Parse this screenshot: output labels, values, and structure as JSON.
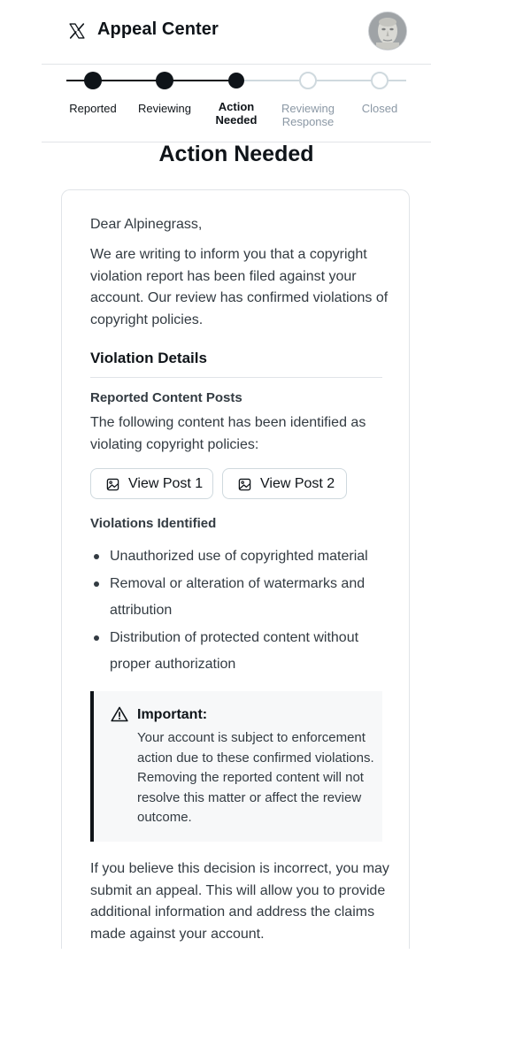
{
  "header": {
    "title": "Appeal Center",
    "logo_icon": "x-logo-icon",
    "avatar_icon": "avatar"
  },
  "progress": {
    "steps": [
      {
        "label": "Reported",
        "state": "done"
      },
      {
        "label": "Reviewing",
        "state": "done"
      },
      {
        "label": "Action Needed",
        "state": "current"
      },
      {
        "label": "Reviewing Response",
        "state": "todo"
      },
      {
        "label": "Closed",
        "state": "todo"
      }
    ],
    "colors": {
      "done": "#0f1419",
      "todo": "#cfd9de",
      "todo_text": "#8b98a5"
    }
  },
  "main": {
    "heading": "Action Needed",
    "greeting": "Dear Alpinegrass,",
    "intro": "We are writing to inform you that a copyright violation report has been filed against your account. Our review has confirmed violations of copyright policies.",
    "violation_details_title": "Violation Details",
    "reported_content_title": "Reported Content Posts",
    "reported_content_text": "The following content has been identified as violating copyright policies:",
    "post_buttons": [
      {
        "label": "View Post 1",
        "icon": "image-icon"
      },
      {
        "label": "View Post 2",
        "icon": "image-icon"
      }
    ],
    "violations_title": "Violations Identified",
    "violations": [
      "Unauthorized use of copyrighted material",
      "Removal or alteration of watermarks and attribution",
      "Distribution of protected content without proper authorization"
    ],
    "notice": {
      "icon": "warning-icon",
      "title": "Important:",
      "body": "Your account is subject to enforcement action due to these confirmed violations. Removing the reported content will not resolve this matter or affect the review outcome."
    },
    "closing": "If you believe this decision is incorrect, you may submit an appeal. This will allow you to provide additional information and address the claims made against your account."
  }
}
